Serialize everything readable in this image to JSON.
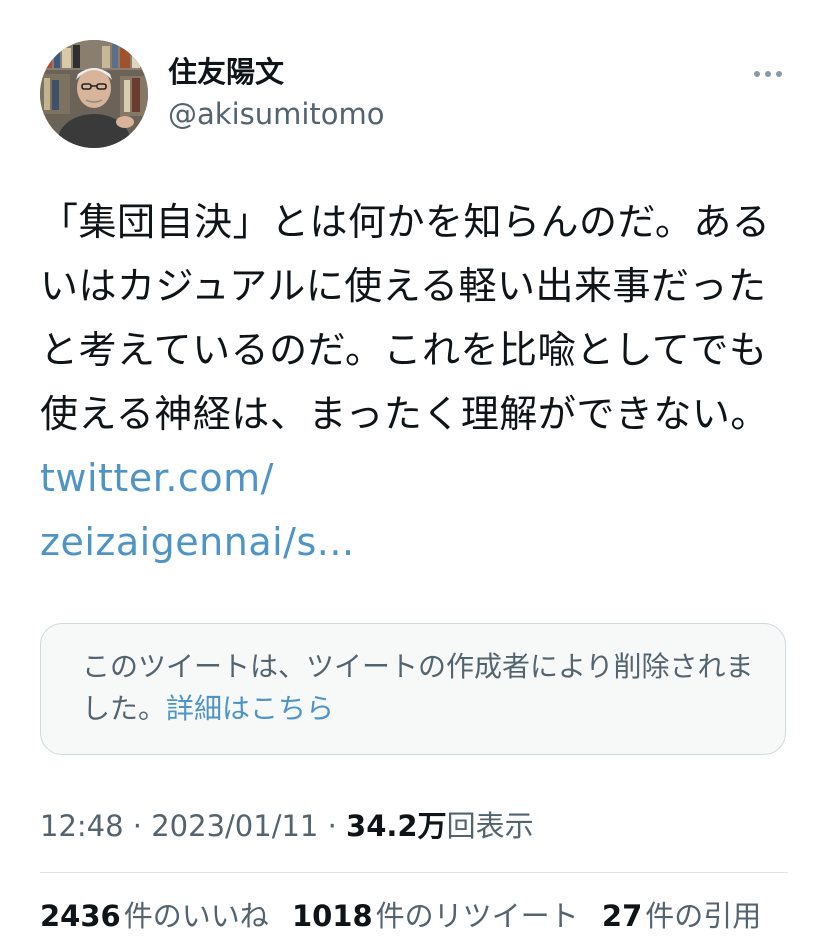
{
  "author": {
    "display_name": "住友陽文",
    "handle": "@akisumitomo"
  },
  "tweet": {
    "text": "「集団自決」とは何かを知らんのだ。あるいはカジュアルに使える軽い出来事だったと考えているのだ。これを比喩としてでも使える神経は、まったく理解ができない。",
    "link_line1": "twitter.com/",
    "link_line2": "zeizaigennai/s..."
  },
  "quoted_card": {
    "message": "このツイートは、ツイートの作成者により削除されました。",
    "detail_link": "詳細はこちら"
  },
  "meta": {
    "time": "12:48",
    "separator1": "·",
    "date": "2023/01/11",
    "separator2": "·",
    "views_count": "34.2万",
    "views_label": "回表示"
  },
  "stats": {
    "likes_count": "2436",
    "likes_label": "件のいいね",
    "retweets_count": "1018",
    "retweets_label": "件のリツイート",
    "quotes_count": "27",
    "quotes_label": "件の引用"
  },
  "icons": {
    "more": "more-horizontal-icon"
  },
  "colors": {
    "link": "#4f94c7",
    "secondary_text": "#536471",
    "primary_text": "#0f1419",
    "card_bg": "#f7f9f9",
    "card_border": "#cfd9de"
  }
}
